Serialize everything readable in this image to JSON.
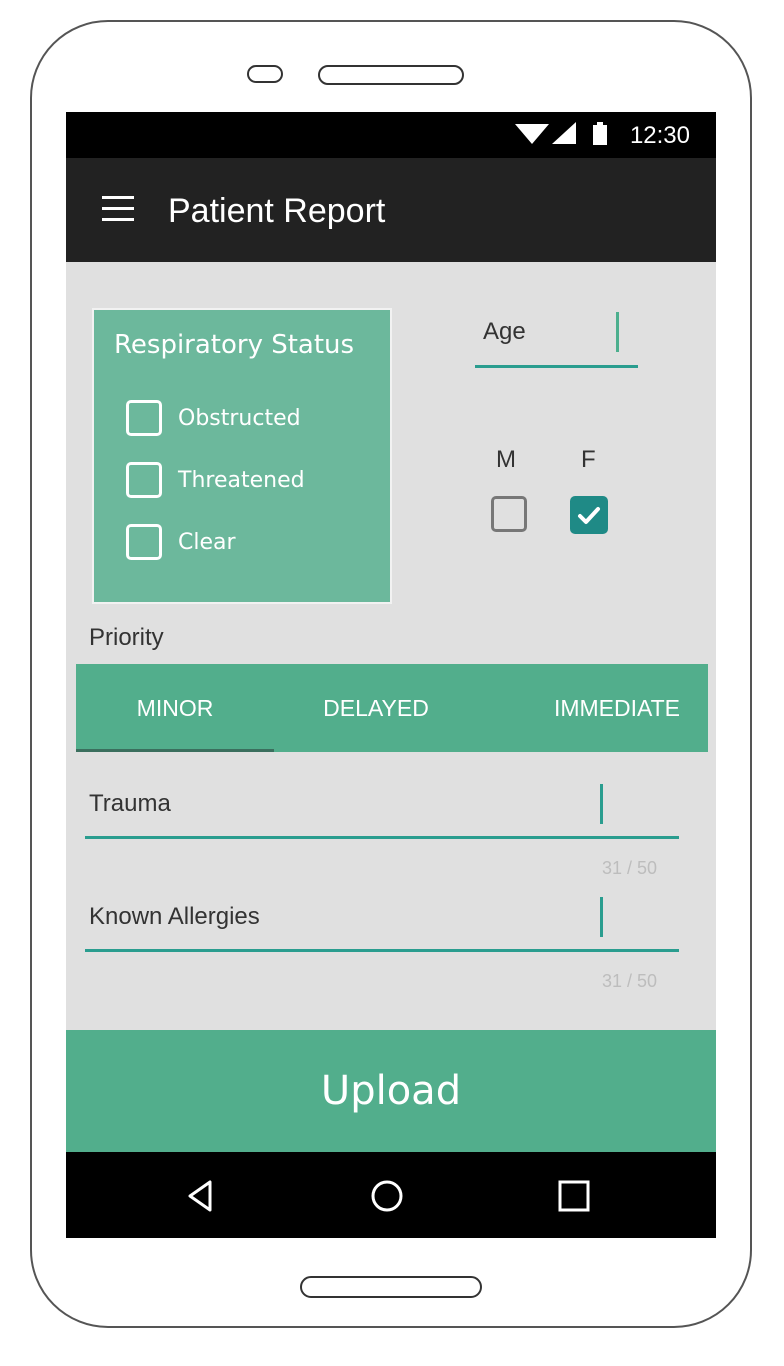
{
  "status_bar": {
    "time": "12:30",
    "icons": [
      "wifi-icon",
      "cell-signal-icon",
      "battery-icon"
    ]
  },
  "app_bar": {
    "title": "Patient Report",
    "menu_icon": "hamburger-menu-icon"
  },
  "respiratory": {
    "title": "Respiratory Status",
    "options": [
      {
        "label": "Obstructed",
        "checked": false
      },
      {
        "label": "Threatened",
        "checked": false
      },
      {
        "label": "Clear",
        "checked": false
      }
    ]
  },
  "age": {
    "label": "Age",
    "value": ""
  },
  "sex": {
    "m_label": "M",
    "f_label": "F",
    "m_checked": false,
    "f_checked": true
  },
  "priority": {
    "label": "Priority",
    "tabs": [
      "MINOR",
      "DELAYED",
      "IMMEDIATE"
    ],
    "selected": "MINOR"
  },
  "fields": {
    "trauma": {
      "label": "Trauma",
      "counter": "31 / 50"
    },
    "allergies": {
      "label": "Known Allergies",
      "counter": "31 / 50"
    }
  },
  "upload_label": "Upload",
  "nav": {
    "icons": [
      "back-icon",
      "home-icon",
      "recents-icon"
    ]
  },
  "colors": {
    "accent": "#52ae8c",
    "card": "#6cb89c",
    "teal_line": "#2a9d8f",
    "checkbox_checked": "#1f8a86",
    "app_bar": "#222222",
    "screen_bg": "#e0e0e0"
  }
}
